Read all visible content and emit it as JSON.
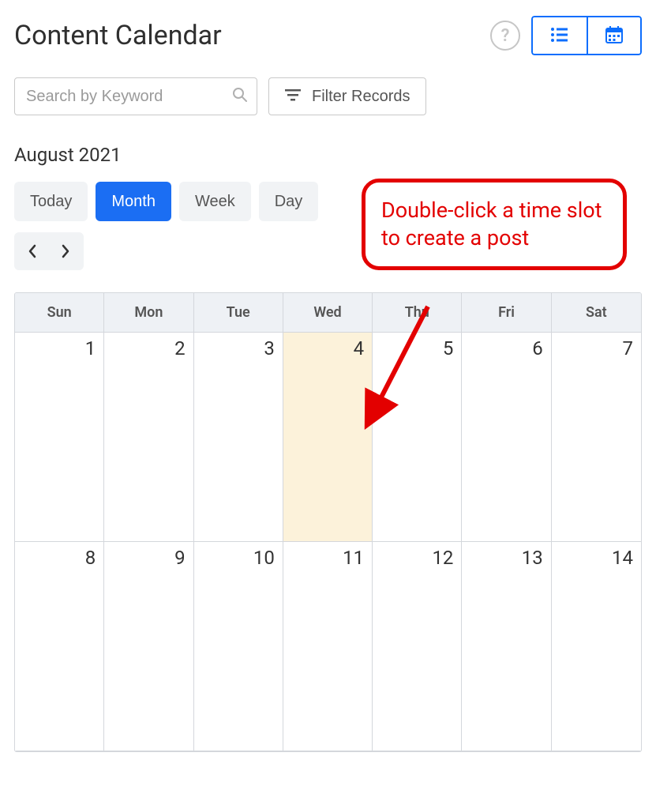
{
  "header": {
    "title": "Content Calendar",
    "help_tooltip": "?",
    "views": {
      "list": "list",
      "calendar": "calendar"
    }
  },
  "search": {
    "placeholder": "Search by Keyword"
  },
  "filter": {
    "label": "Filter Records"
  },
  "period": {
    "label": "August 2021"
  },
  "modes": {
    "today": "Today",
    "month": "Month",
    "week": "Week",
    "day": "Day",
    "active": "month"
  },
  "calendar": {
    "weekdays": [
      "Sun",
      "Mon",
      "Tue",
      "Wed",
      "Thu",
      "Fri",
      "Sat"
    ],
    "rows": [
      {
        "dates": [
          1,
          2,
          3,
          4,
          5,
          6,
          7
        ],
        "highlight_index": 3
      },
      {
        "dates": [
          8,
          9,
          10,
          11,
          12,
          13,
          14
        ],
        "highlight_index": -1
      }
    ]
  },
  "annotation": {
    "text": "Double-click a time slot to create a post",
    "color": "#e30000"
  }
}
